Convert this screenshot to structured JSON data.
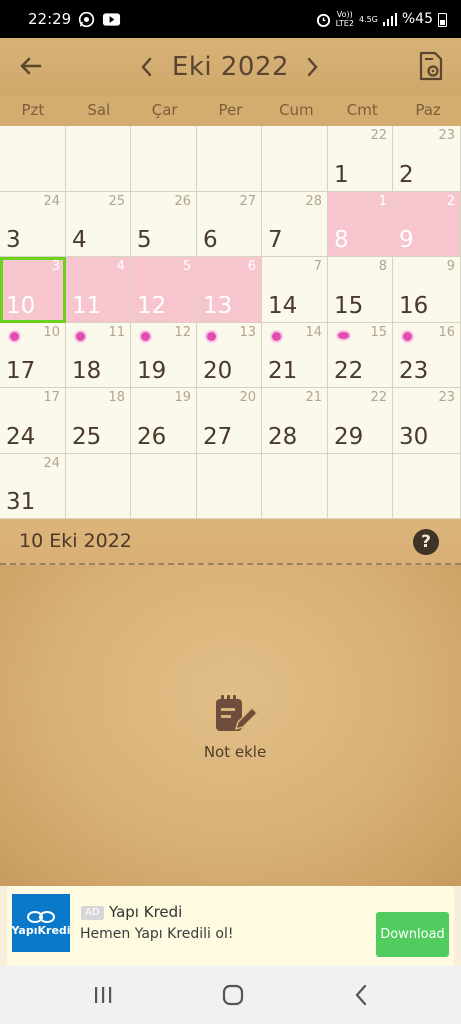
{
  "status_bar": {
    "time": "22:29",
    "volte": "Vo))",
    "lte": "LTE2",
    "net": "4.5G",
    "battery": "%45"
  },
  "toolbar": {
    "month_title": "Eki 2022",
    "back_icon": "arrow-left-icon",
    "prev_icon": "chevron-left-icon",
    "next_icon": "chevron-right-icon",
    "doc_icon": "document-settings-icon"
  },
  "weekdays": [
    "Pzt",
    "Sal",
    "Çar",
    "Per",
    "Cum",
    "Cmt",
    "Paz"
  ],
  "calendar": {
    "rows": [
      [
        {
          "sm": "",
          "big": ""
        },
        {
          "sm": "",
          "big": ""
        },
        {
          "sm": "",
          "big": ""
        },
        {
          "sm": "",
          "big": ""
        },
        {
          "sm": "",
          "big": ""
        },
        {
          "sm": "22",
          "big": "1"
        },
        {
          "sm": "23",
          "big": "2"
        }
      ],
      [
        {
          "sm": "24",
          "big": "3"
        },
        {
          "sm": "25",
          "big": "4"
        },
        {
          "sm": "26",
          "big": "5"
        },
        {
          "sm": "27",
          "big": "6"
        },
        {
          "sm": "28",
          "big": "7"
        },
        {
          "sm": "1",
          "big": "8",
          "pink": true
        },
        {
          "sm": "2",
          "big": "9",
          "pink": true
        }
      ],
      [
        {
          "sm": "3",
          "big": "10",
          "pink": true,
          "today": true
        },
        {
          "sm": "4",
          "big": "11",
          "pink": true
        },
        {
          "sm": "5",
          "big": "12",
          "pink": true
        },
        {
          "sm": "6",
          "big": "13",
          "pink": true
        },
        {
          "sm": "7",
          "big": "14"
        },
        {
          "sm": "8",
          "big": "15"
        },
        {
          "sm": "9",
          "big": "16"
        }
      ],
      [
        {
          "sm": "10",
          "big": "17",
          "dot": "circle"
        },
        {
          "sm": "11",
          "big": "18",
          "dot": "circle"
        },
        {
          "sm": "12",
          "big": "19",
          "dot": "circle"
        },
        {
          "sm": "13",
          "big": "20",
          "dot": "circle"
        },
        {
          "sm": "14",
          "big": "21",
          "dot": "circle"
        },
        {
          "sm": "15",
          "big": "22",
          "dot": "oval"
        },
        {
          "sm": "16",
          "big": "23",
          "dot": "circle"
        }
      ],
      [
        {
          "sm": "17",
          "big": "24"
        },
        {
          "sm": "18",
          "big": "25"
        },
        {
          "sm": "19",
          "big": "26"
        },
        {
          "sm": "20",
          "big": "27"
        },
        {
          "sm": "21",
          "big": "28"
        },
        {
          "sm": "22",
          "big": "29"
        },
        {
          "sm": "23",
          "big": "30"
        }
      ],
      [
        {
          "sm": "24",
          "big": "31"
        },
        {
          "sm": "",
          "big": ""
        },
        {
          "sm": "",
          "big": ""
        },
        {
          "sm": "",
          "big": ""
        },
        {
          "sm": "",
          "big": ""
        },
        {
          "sm": "",
          "big": ""
        },
        {
          "sm": "",
          "big": ""
        }
      ]
    ]
  },
  "notes": {
    "date": "10 Eki 2022",
    "help": "?",
    "add_label": "Not ekle"
  },
  "ad": {
    "badge": "AD",
    "title": "Yapı Kredi",
    "subtitle": "Hemen Yapı Kredili ol!",
    "button": "Download",
    "logo_text": "YapıKredi"
  },
  "colors": {
    "period_pink": "#f7c5cd",
    "today_outline": "#6ad11e",
    "fertile_dot": "#e24cae",
    "toolbar": "#d3ad70",
    "ad_button": "#51cc5e"
  }
}
